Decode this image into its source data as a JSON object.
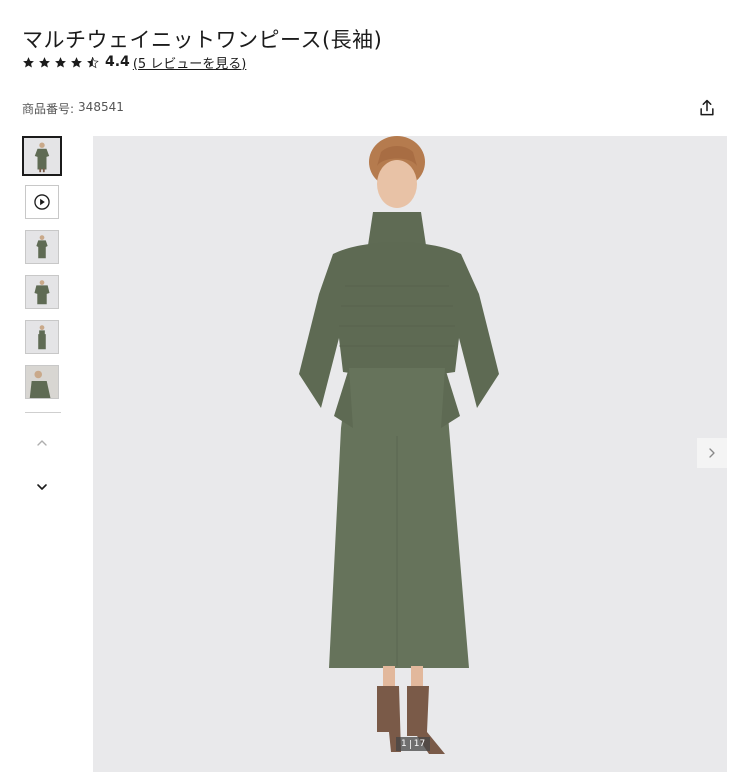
{
  "product": {
    "title": "マルチウェイニットワンピース(長袖)",
    "rating": 4.4,
    "rating_text": "4.4",
    "stars_label": "★★★★½",
    "review_link": "(5 レビューを見る)",
    "sku_label": "商品番号:",
    "sku_value": "348541"
  },
  "gallery": {
    "current_label": "1",
    "total_label": "17",
    "thumbnails": [
      {
        "kind": "image",
        "active": true
      },
      {
        "kind": "video",
        "active": false
      },
      {
        "kind": "image",
        "active": false
      },
      {
        "kind": "image",
        "active": false
      },
      {
        "kind": "image",
        "active": false
      },
      {
        "kind": "image",
        "active": false
      }
    ]
  },
  "icons": {
    "share": "share-icon",
    "play": "play-icon",
    "chevron_up": "chevron-up-icon",
    "chevron_down": "chevron-down-icon",
    "chevron_right": "chevron-right-icon",
    "star": "star-icon"
  },
  "colors": {
    "text": "#1b1b1b",
    "garment": "#5f6b54",
    "photo_background": "#e9e9eb",
    "boots": "#7a5a48"
  }
}
